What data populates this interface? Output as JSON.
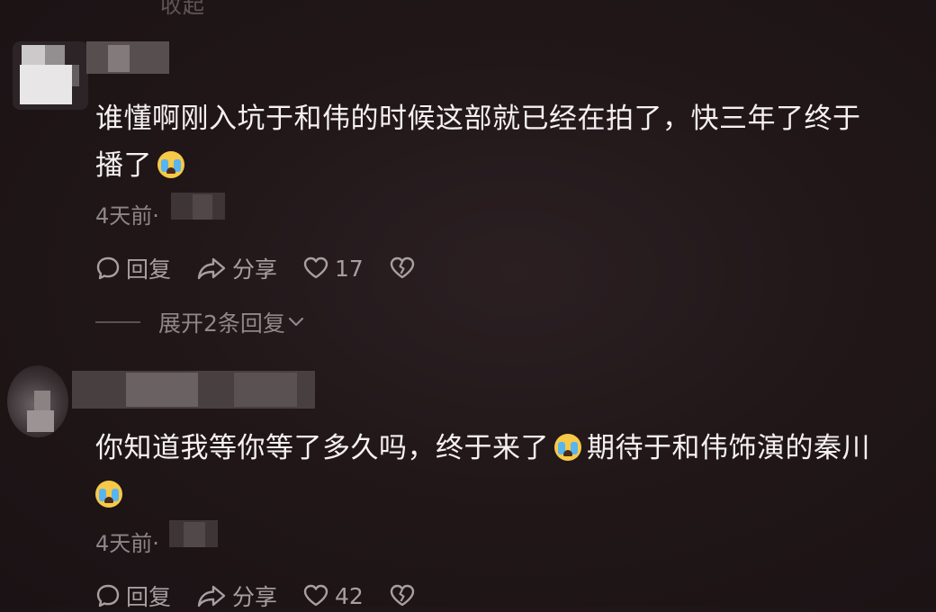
{
  "top_partial_label": "收起",
  "comments": [
    {
      "text_line1": "谁懂啊刚入坑于和伟的时候这部就已经在拍了，快三年了终于",
      "text_line2": "播了",
      "time": "4天前·",
      "reply_label": "回复",
      "share_label": "分享",
      "like_count": "17",
      "expand_label": "展开2条回复"
    },
    {
      "text_line1a": "你知道我等你等了多久吗，终于来了",
      "text_line1b": "期待于和伟饰演的秦川",
      "time": "4天前·",
      "reply_label": "回复",
      "share_label": "分享",
      "like_count": "42"
    }
  ],
  "icons": {
    "reply": "comment-bubble-icon",
    "share": "share-arrow-icon",
    "like": "heart-outline-icon",
    "dislike": "broken-heart-icon",
    "emoji": "loudly-crying-face-emoji",
    "expand": "chevron-down-icon"
  }
}
